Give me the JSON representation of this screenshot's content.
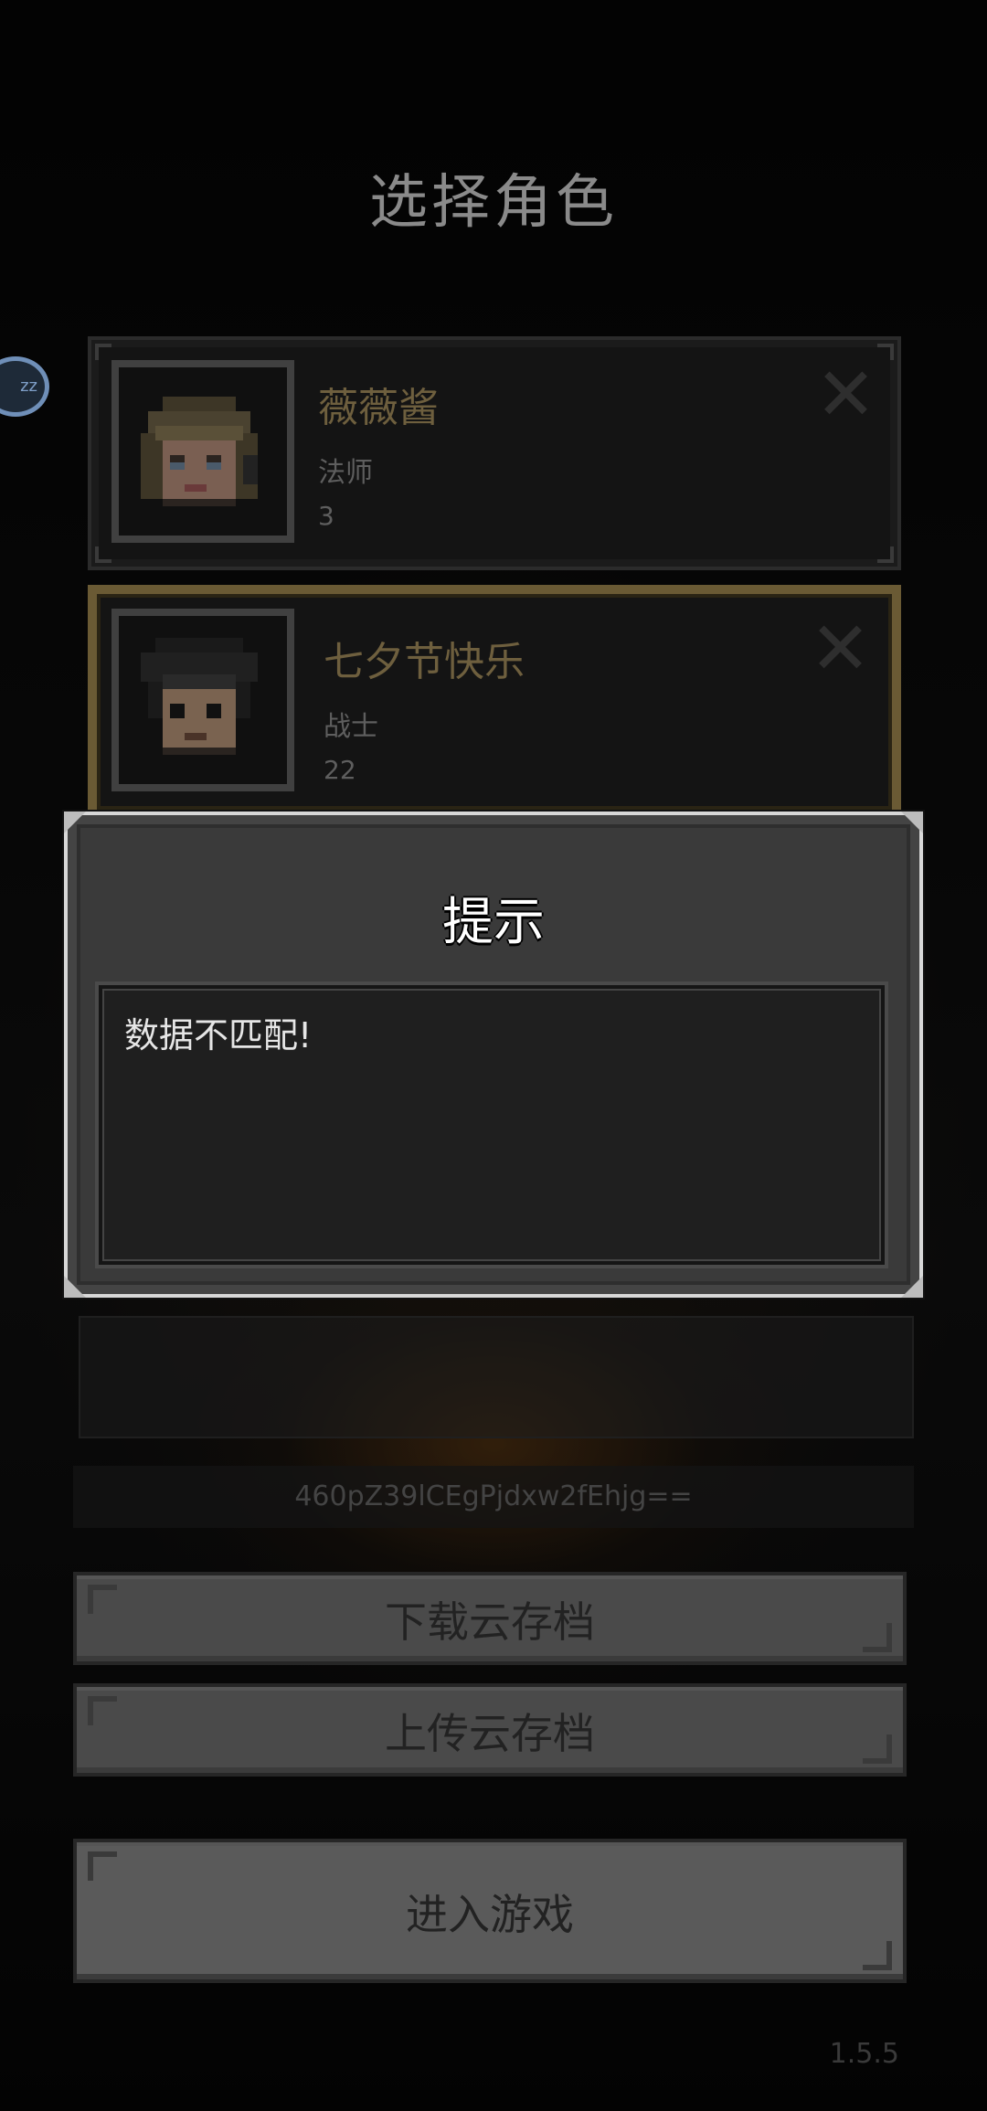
{
  "screen": {
    "title": "选择角色",
    "side_badge": "zz",
    "version": "1.5.5"
  },
  "characters": [
    {
      "name": "薇薇酱",
      "class": "法师",
      "level": "3",
      "selected": false,
      "portrait": "mage-portrait"
    },
    {
      "name": "七夕节快乐",
      "class": "战士",
      "level": "22",
      "selected": true,
      "portrait": "warrior-portrait"
    }
  ],
  "account_code": "460pZ39lCEgPjdxw2fEhjg==",
  "buttons": {
    "download": "下载云存档",
    "upload": "上传云存档",
    "enter": "进入游戏"
  },
  "dialog": {
    "title": "提示",
    "message": "数据不匹配!"
  },
  "colors": {
    "name_gold": "#6e5f3e",
    "selected_border": "#6a5a34",
    "dialog_border": "#d8d8d8"
  }
}
